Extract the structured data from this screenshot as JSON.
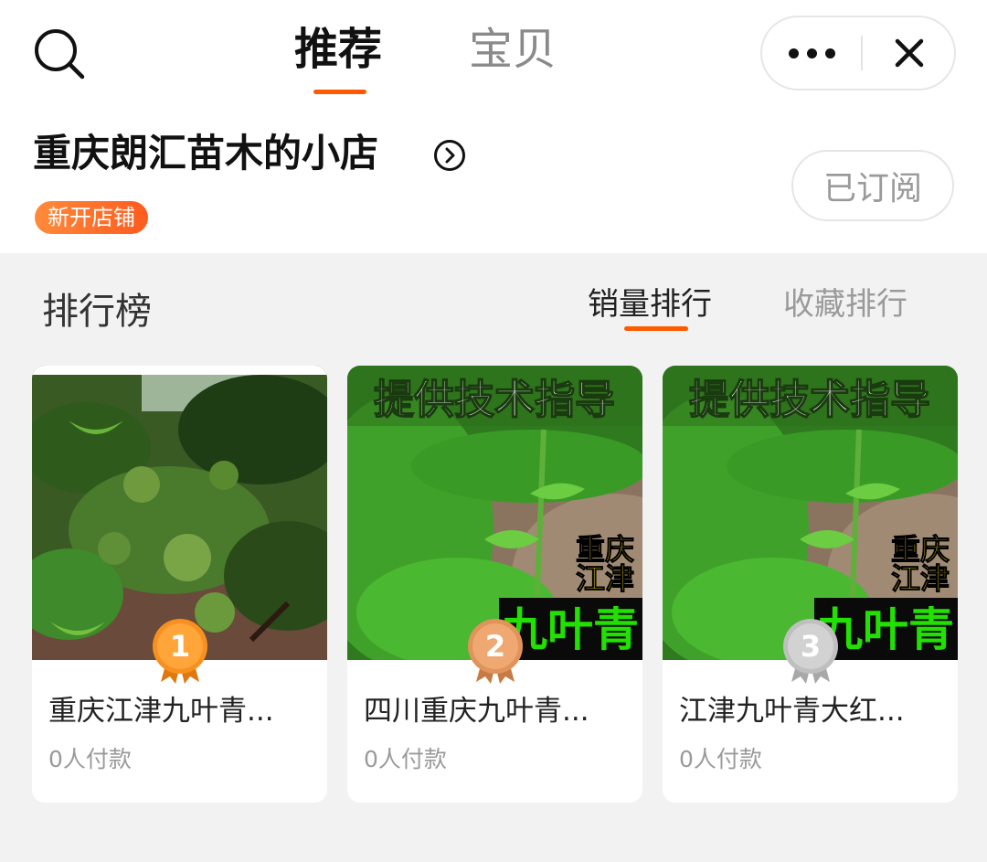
{
  "header": {
    "search_icon": "search-icon",
    "tabs": [
      {
        "label": "推荐",
        "active": true
      },
      {
        "label": "宝贝",
        "active": false
      }
    ],
    "more_icon": "more-dots-icon",
    "close_icon": "close-icon"
  },
  "shop": {
    "name": "重庆朗汇苗木的小店",
    "arrow_icon": "chevron-right-circle-icon",
    "tag": "新开店铺",
    "subscribe_label": "已订阅"
  },
  "ranking": {
    "title": "排行榜",
    "sort_options": [
      {
        "label": "销量排行",
        "active": true
      },
      {
        "label": "收藏排行",
        "active": false
      }
    ]
  },
  "products": [
    {
      "rank": "1",
      "name": "重庆江津九叶青...",
      "sold": "0人付款",
      "medal_color": "#f7901e"
    },
    {
      "rank": "2",
      "name": "四川重庆九叶青...",
      "sold": "0人付款",
      "medal_color": "#e0935a",
      "banner_top": "提供技术指导",
      "banner_side": [
        "重庆",
        "江津"
      ],
      "banner_bottom": "九叶青"
    },
    {
      "rank": "3",
      "name": "江津九叶青大红...",
      "sold": "0人付款",
      "medal_color": "#bfbfbf",
      "banner_top": "提供技术指导",
      "banner_side": [
        "重庆",
        "江津"
      ],
      "banner_bottom": "九叶青"
    }
  ],
  "colors": {
    "accent": "#ff5a00",
    "tag_gradient_start": "#ff8a3a",
    "tag_gradient_end": "#ff5b1f",
    "banner_yellow": "#ffe600",
    "banner_green": "#22e000"
  }
}
